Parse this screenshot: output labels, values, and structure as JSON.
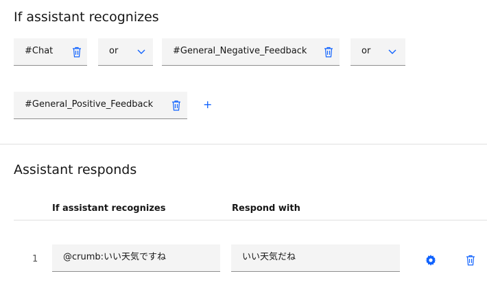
{
  "condition_section": {
    "title": "If assistant recognizes",
    "conditions": [
      {
        "value": "#Chat"
      },
      {
        "operator": "or"
      },
      {
        "value": "#General_Negative_Feedback"
      },
      {
        "operator": "or"
      },
      {
        "value": "#General_Positive_Feedback"
      }
    ],
    "add_label": "+"
  },
  "response_section": {
    "title": "Assistant responds",
    "columns": [
      "If assistant recognizes",
      "Respond with"
    ],
    "rows": [
      {
        "index": "1",
        "condition": "@crumb:いい天気ですね",
        "response": "いい天気だね"
      }
    ]
  },
  "colors": {
    "accent": "#0f62fe",
    "field_bg": "#f4f4f4",
    "trash": "#0f62fe"
  },
  "icons": {
    "delete": "trash-icon",
    "dropdown": "chevron-down-icon",
    "settings": "gear-icon",
    "add": "plus-icon"
  }
}
